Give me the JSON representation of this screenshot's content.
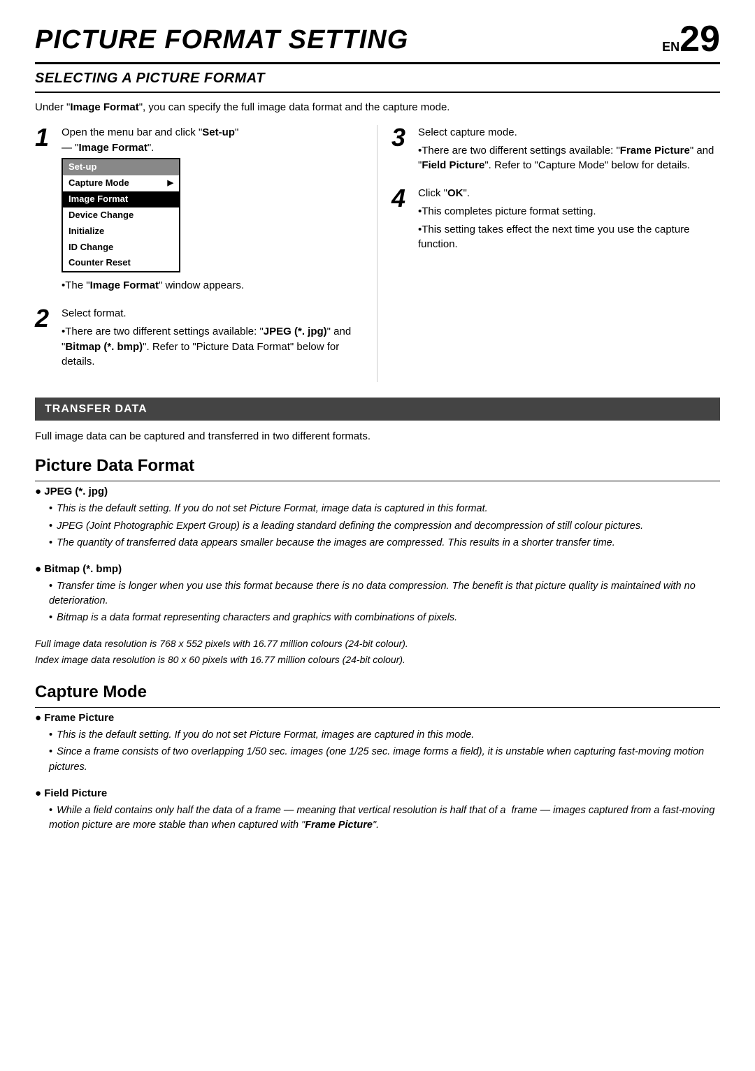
{
  "header": {
    "title": "PICTURE FORMAT SETTING",
    "en_label": "EN",
    "page_number": "29"
  },
  "subtitle": "SELECTING A PICTURE FORMAT",
  "intro": "Under \"Image Format\", you can specify the full image data format and the capture mode.",
  "steps": [
    {
      "number": "1",
      "lines": [
        "Open the menu bar and click \"Set-up\" — \"Image Format\".",
        "•The \"Image Format\" window appears."
      ],
      "menu": {
        "title": "Set-up",
        "items": [
          {
            "label": "Capture Mode",
            "arrow": "▶",
            "selected": false
          },
          {
            "label": "Image Format",
            "arrow": "",
            "selected": true
          },
          {
            "label": "Device Change",
            "arrow": "",
            "selected": false
          },
          {
            "label": "Initialize",
            "arrow": "",
            "selected": false
          },
          {
            "label": "ID Change",
            "arrow": "",
            "selected": false
          },
          {
            "label": "Counter Reset",
            "arrow": "",
            "selected": false
          }
        ]
      }
    },
    {
      "number": "2",
      "lines": [
        "Select format.",
        "•There are two different settings available: \"JPEG (*. jpg)\" and \"Bitmap (*. bmp)\". Refer to \"Picture Data Format\" below for details."
      ]
    },
    {
      "number": "3",
      "lines": [
        "Select capture mode.",
        "•There are two different settings available: \"Frame Picture\" and \"Field Picture\". Refer to \"Capture Mode\" below for details."
      ]
    },
    {
      "number": "4",
      "lines": [
        "Click \"OK\".",
        "•This completes picture format setting.",
        "•This setting takes effect the next time you use the capture function."
      ]
    }
  ],
  "transfer_banner": "TRANSFER DATA",
  "transfer_intro": "Full image data can be captured and transferred in two different formats.",
  "picture_data_format": {
    "heading": "Picture Data Format",
    "jpeg": {
      "heading": "JPEG (*. jpg)",
      "bullets": [
        "This is the default setting. If you do not set Picture Format, image data is captured in this format.",
        "JPEG (Joint Photographic Expert Group) is a leading standard defining the compression and decompression of still colour pictures.",
        "The quantity of transferred data appears smaller because the images are compressed. This results in a shorter transfer time."
      ]
    },
    "bitmap": {
      "heading": "Bitmap (*. bmp)",
      "bullets": [
        "Transfer time is longer when you use this format because there is no data compression. The benefit is that picture quality is maintained with no deterioration.",
        "Bitmap is a data format representing characters and graphics with combinations of pixels."
      ]
    },
    "resolution_note1": "Full image data resolution is 768 x 552 pixels with 16.77 million colours (24-bit colour).",
    "resolution_note2": "Index image data resolution is 80 x 60 pixels with 16.77 million colours (24-bit colour)."
  },
  "capture_mode": {
    "heading": "Capture Mode",
    "frame_picture": {
      "heading": "Frame Picture",
      "bullets": [
        "This is the default setting. If you do not set Picture Format, images are captured in this mode.",
        "Since a frame consists of two overlapping 1/50 sec. images (one 1/25 sec. image forms a field), it is unstable when capturing fast-moving motion pictures."
      ]
    },
    "field_picture": {
      "heading": "Field Picture",
      "bullets": [
        "While a field contains only half the data of a frame — meaning that vertical resolution is half that of a  frame — images captured from a fast-moving motion picture are more stable than when captured with \"Frame Picture\"."
      ]
    }
  }
}
